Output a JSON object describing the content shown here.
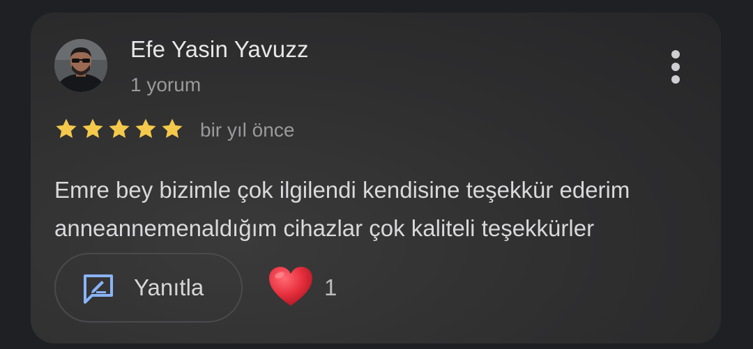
{
  "review": {
    "author": "Efe Yasin Yavuzz",
    "review_count": "1 yorum",
    "rating": 5,
    "rating_max": 5,
    "time": "bir yıl önce",
    "text_line1": "Emre bey bizimle çok ilgilendi kendisine teşekkür ederim",
    "text_line2": "anneannemenaldığım cihazlar çok kaliteli teşekkürler"
  },
  "actions": {
    "reply_label": "Yanıtla",
    "like_count": "1"
  },
  "icons": {
    "menu": "more-vert-icon",
    "star": "star-icon",
    "reply": "reply-icon",
    "like": "heart-icon"
  },
  "colors": {
    "star": "#f4c94b",
    "heart": "#e8303e",
    "reply_icon": "#8ab4f8"
  }
}
